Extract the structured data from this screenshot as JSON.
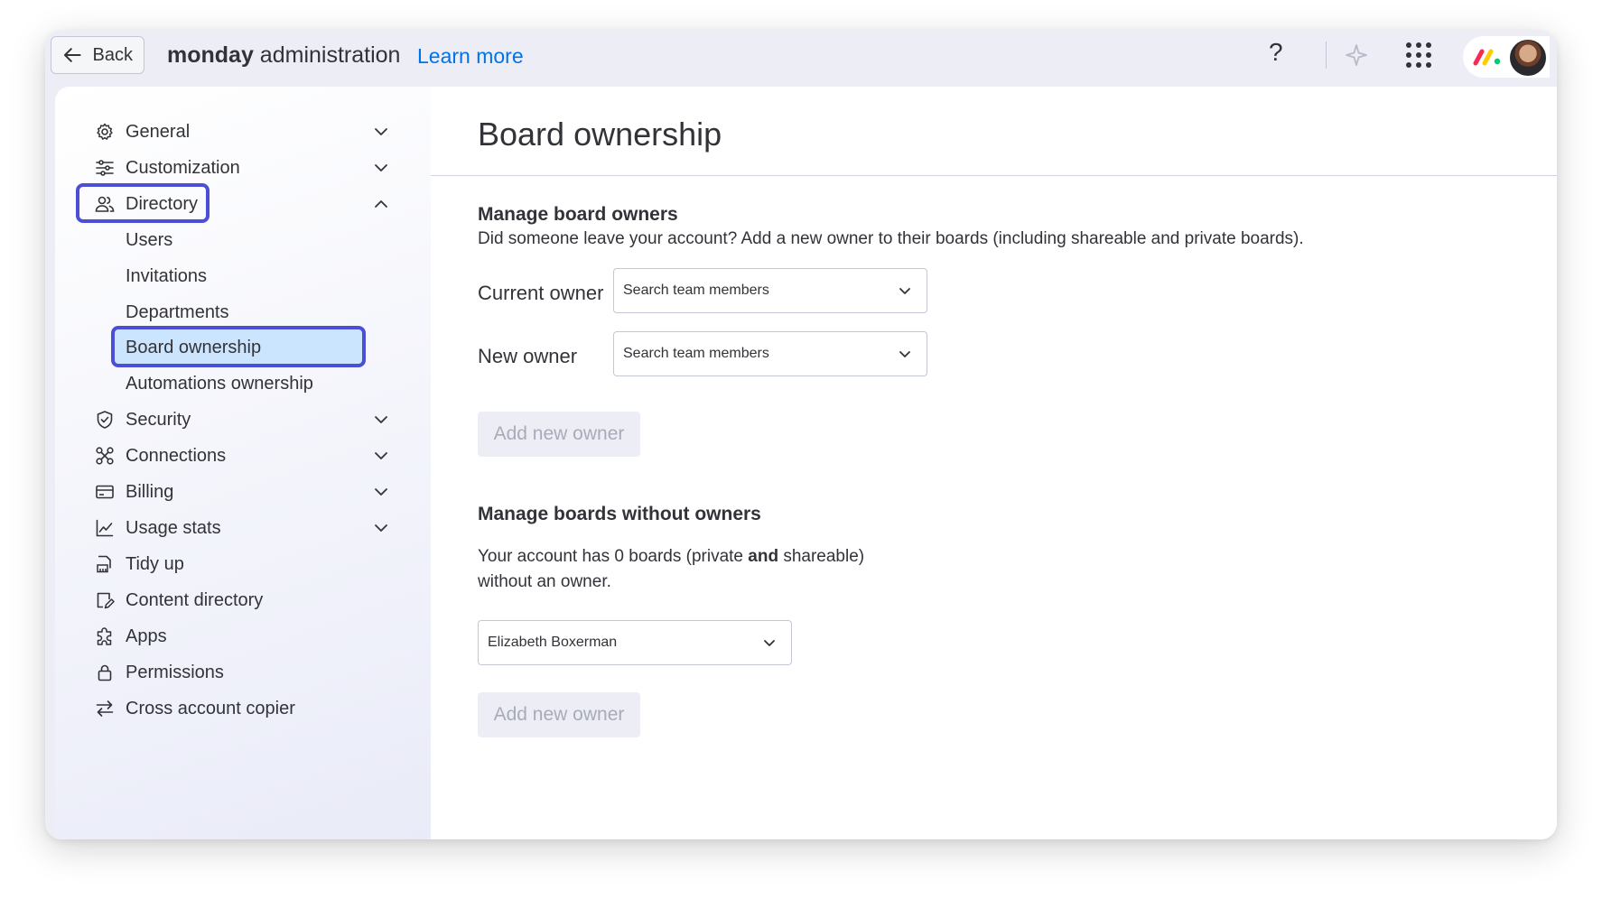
{
  "topbar": {
    "back_label": "Back",
    "brand_bold": "monday",
    "brand_rest": " administration",
    "learn_more": "Learn more",
    "help_glyph": "?"
  },
  "sidebar": {
    "items": [
      {
        "label": "General",
        "icon": "gear-icon",
        "chevron": "down"
      },
      {
        "label": "Customization",
        "icon": "sliders-icon",
        "chevron": "down"
      },
      {
        "label": "Directory",
        "icon": "people-icon",
        "chevron": "up"
      },
      {
        "label": "Security",
        "icon": "shield-icon",
        "chevron": "down"
      },
      {
        "label": "Connections",
        "icon": "connections-icon",
        "chevron": "down"
      },
      {
        "label": "Billing",
        "icon": "card-icon",
        "chevron": "down"
      },
      {
        "label": "Usage stats",
        "icon": "chart-icon",
        "chevron": "down"
      },
      {
        "label": "Tidy up",
        "icon": "broom-icon"
      },
      {
        "label": "Content directory",
        "icon": "content-icon"
      },
      {
        "label": "Apps",
        "icon": "puzzle-icon"
      },
      {
        "label": "Permissions",
        "icon": "lock-icon"
      },
      {
        "label": "Cross account copier",
        "icon": "swap-icon"
      }
    ],
    "directory_subitems": [
      "Users",
      "Invitations",
      "Departments",
      "Board ownership",
      "Automations ownership"
    ]
  },
  "main": {
    "title": "Board ownership",
    "section1": {
      "heading": "Manage board owners",
      "description": "Did someone leave your account? Add a new owner to their boards (including shareable and private boards).",
      "current_owner_label": "Current owner",
      "current_owner_placeholder": "Search team members",
      "new_owner_label": "New owner",
      "new_owner_placeholder": "Search team members",
      "button_label": "Add new owner"
    },
    "section2": {
      "heading": "Manage boards without owners",
      "text_part1": "Your account has 0 boards (private ",
      "text_bold": "and",
      "text_part2": " shareable)",
      "text_line2": "without an owner.",
      "selected_owner": "Elizabeth Boxerman",
      "button_label": "Add new owner"
    }
  },
  "colors": {
    "accent": "#0073ea",
    "highlight_border": "#4a4fd6",
    "selected_bg": "#cce5ff"
  }
}
